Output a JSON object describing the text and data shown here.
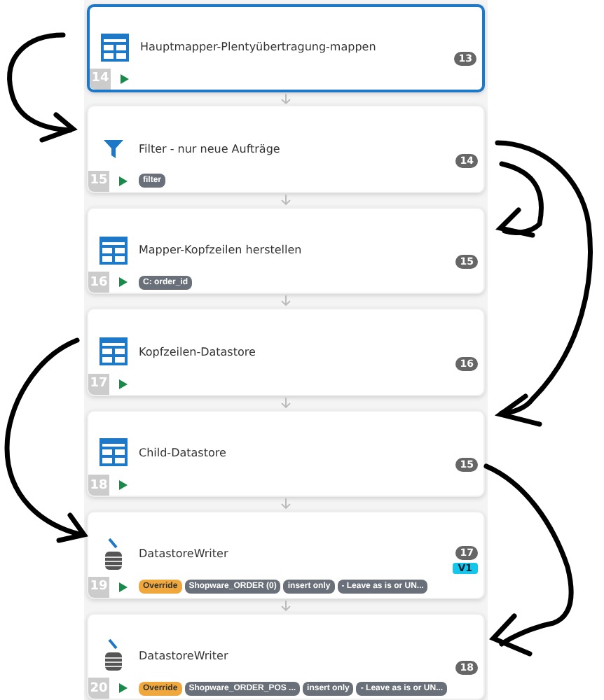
{
  "steps": [
    {
      "kind": "mapper",
      "title": "Hauptmapper-Plentyübertragung-mappen",
      "count": "13",
      "number": "14",
      "selected": true
    },
    {
      "kind": "filter",
      "title": "Filter - nur neue Aufträge",
      "count": "14",
      "number": "15",
      "selected": false,
      "tags": [
        {
          "kind": "plain",
          "text": "filter"
        }
      ]
    },
    {
      "kind": "mapper",
      "title": "Mapper-Kopfzeilen herstellen",
      "count": "15",
      "number": "16",
      "selected": false,
      "tags": [
        {
          "kind": "plain",
          "text": "C: order_id"
        }
      ]
    },
    {
      "kind": "mapper",
      "title": "Kopfzeilen-Datastore",
      "count": "16",
      "number": "17",
      "selected": false
    },
    {
      "kind": "mapper",
      "title": "Child-Datastore",
      "count": "15",
      "number": "18",
      "selected": false
    },
    {
      "kind": "writer",
      "title": "DatastoreWriter",
      "count": "17",
      "version": "V1",
      "number": "19",
      "selected": false,
      "tags": [
        {
          "kind": "override",
          "text": "Override"
        },
        {
          "kind": "plain",
          "text": "Shopware_ORDER (0)"
        },
        {
          "kind": "plain",
          "text": "insert only"
        },
        {
          "kind": "plain",
          "text": "- Leave as is or UN..."
        }
      ]
    },
    {
      "kind": "writer",
      "title": "DatastoreWriter",
      "count": "18",
      "number": "20",
      "selected": false,
      "tags": [
        {
          "kind": "override",
          "text": "Override"
        },
        {
          "kind": "plain",
          "text": "Shopware_ORDER_POS ..."
        },
        {
          "kind": "plain",
          "text": "insert only"
        },
        {
          "kind": "plain",
          "text": "- Leave as is or UN..."
        }
      ]
    }
  ]
}
